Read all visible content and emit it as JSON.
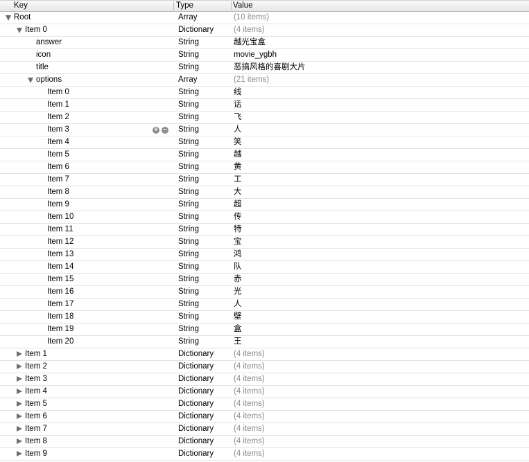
{
  "header": {
    "key": "Key",
    "type": "Type",
    "value": "Value"
  },
  "rows": [
    {
      "key": "Root",
      "type": "Array",
      "value": "(10 items)",
      "level": 0,
      "disclosure": "open",
      "dim": true
    },
    {
      "key": "Item 0",
      "type": "Dictionary",
      "value": "(4 items)",
      "level": 1,
      "disclosure": "open",
      "dim": true
    },
    {
      "key": "answer",
      "type": "String",
      "value": "越光宝盒",
      "level": 2
    },
    {
      "key": "icon",
      "type": "String",
      "value": "movie_ygbh",
      "level": 2
    },
    {
      "key": "title",
      "type": "String",
      "value": "恶搞风格的喜剧大片",
      "level": 2
    },
    {
      "key": "options",
      "type": "Array",
      "value": "(21 items)",
      "level": 2,
      "disclosure": "open",
      "dim": true
    },
    {
      "key": "Item 0",
      "type": "String",
      "value": "线",
      "level": 3
    },
    {
      "key": "Item 1",
      "type": "String",
      "value": "话",
      "level": 3
    },
    {
      "key": "Item 2",
      "type": "String",
      "value": "飞",
      "level": 3
    },
    {
      "key": "Item 3",
      "type": "String",
      "value": "人",
      "level": 3,
      "hovered": true
    },
    {
      "key": "Item 4",
      "type": "String",
      "value": "笑",
      "level": 3
    },
    {
      "key": "Item 5",
      "type": "String",
      "value": "越",
      "level": 3
    },
    {
      "key": "Item 6",
      "type": "String",
      "value": "黄",
      "level": 3
    },
    {
      "key": "Item 7",
      "type": "String",
      "value": "工",
      "level": 3
    },
    {
      "key": "Item 8",
      "type": "String",
      "value": "大",
      "level": 3
    },
    {
      "key": "Item 9",
      "type": "String",
      "value": "超",
      "level": 3
    },
    {
      "key": "Item 10",
      "type": "String",
      "value": "传",
      "level": 3
    },
    {
      "key": "Item 11",
      "type": "String",
      "value": "特",
      "level": 3
    },
    {
      "key": "Item 12",
      "type": "String",
      "value": "宝",
      "level": 3
    },
    {
      "key": "Item 13",
      "type": "String",
      "value": "鸿",
      "level": 3
    },
    {
      "key": "Item 14",
      "type": "String",
      "value": "队",
      "level": 3
    },
    {
      "key": "Item 15",
      "type": "String",
      "value": "赤",
      "level": 3
    },
    {
      "key": "Item 16",
      "type": "String",
      "value": "光",
      "level": 3
    },
    {
      "key": "Item 17",
      "type": "String",
      "value": "人",
      "level": 3
    },
    {
      "key": "Item 18",
      "type": "String",
      "value": "壁",
      "level": 3
    },
    {
      "key": "Item 19",
      "type": "String",
      "value": "盒",
      "level": 3
    },
    {
      "key": "Item 20",
      "type": "String",
      "value": "王",
      "level": 3
    },
    {
      "key": "Item 1",
      "type": "Dictionary",
      "value": "(4 items)",
      "level": 1,
      "disclosure": "closed",
      "dim": true
    },
    {
      "key": "Item 2",
      "type": "Dictionary",
      "value": "(4 items)",
      "level": 1,
      "disclosure": "closed",
      "dim": true
    },
    {
      "key": "Item 3",
      "type": "Dictionary",
      "value": "(4 items)",
      "level": 1,
      "disclosure": "closed",
      "dim": true
    },
    {
      "key": "Item 4",
      "type": "Dictionary",
      "value": "(4 items)",
      "level": 1,
      "disclosure": "closed",
      "dim": true
    },
    {
      "key": "Item 5",
      "type": "Dictionary",
      "value": "(4 items)",
      "level": 1,
      "disclosure": "closed",
      "dim": true
    },
    {
      "key": "Item 6",
      "type": "Dictionary",
      "value": "(4 items)",
      "level": 1,
      "disclosure": "closed",
      "dim": true
    },
    {
      "key": "Item 7",
      "type": "Dictionary",
      "value": "(4 items)",
      "level": 1,
      "disclosure": "closed",
      "dim": true
    },
    {
      "key": "Item 8",
      "type": "Dictionary",
      "value": "(4 items)",
      "level": 1,
      "disclosure": "closed",
      "dim": true
    },
    {
      "key": "Item 9",
      "type": "Dictionary",
      "value": "(4 items)",
      "level": 1,
      "disclosure": "closed",
      "dim": true
    }
  ],
  "row_actions": {
    "add": "+",
    "remove": "−"
  }
}
